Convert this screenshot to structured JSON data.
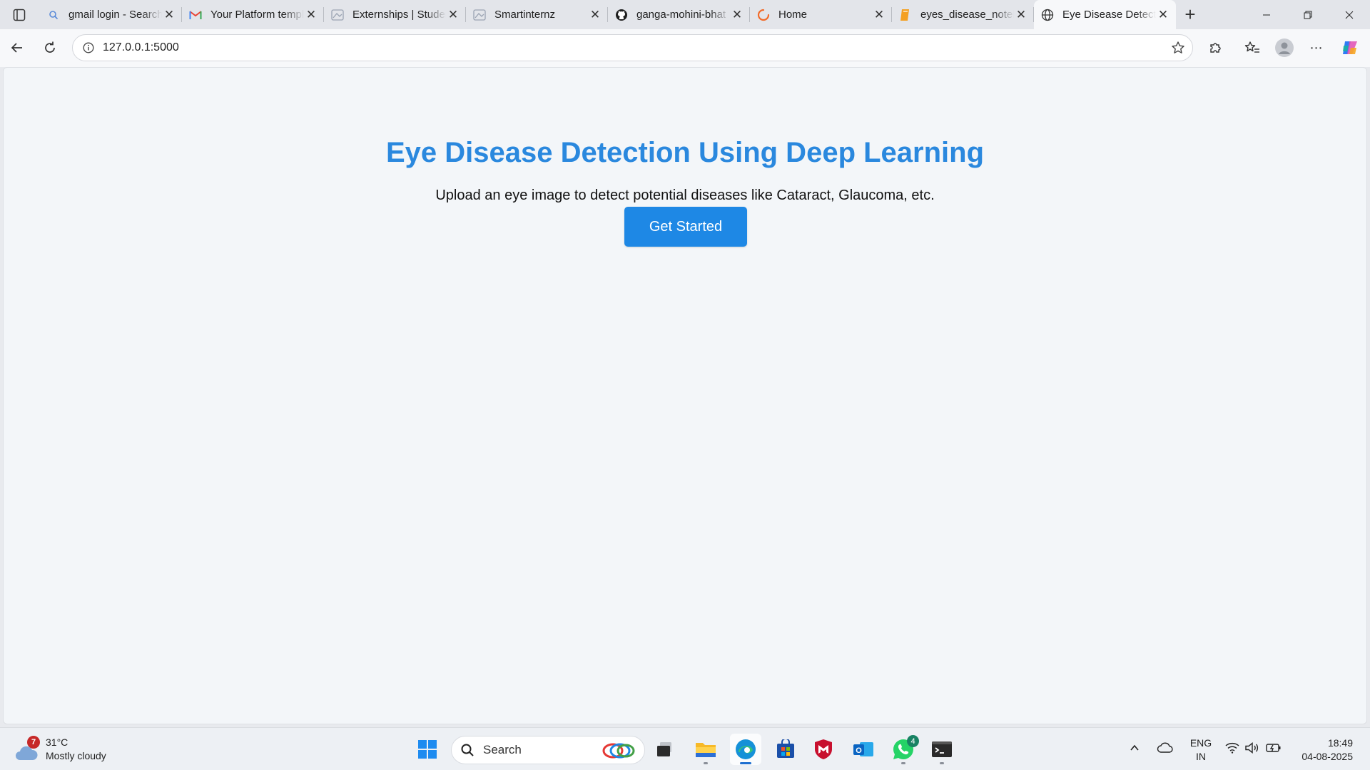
{
  "browser": {
    "tabs": [
      {
        "title": "gmail login - Search",
        "icon": "search-icon"
      },
      {
        "title": "Your Platform templates",
        "icon": "gmail-icon"
      },
      {
        "title": "Externships | Student",
        "icon": "page-icon"
      },
      {
        "title": "Smartinternz",
        "icon": "page-icon"
      },
      {
        "title": "ganga-mohini-bhat",
        "icon": "github-icon"
      },
      {
        "title": "Home",
        "icon": "loading-icon"
      },
      {
        "title": "eyes_disease_notebook",
        "icon": "notebook-icon"
      },
      {
        "title": "Eye Disease Detection",
        "icon": "globe-icon",
        "active": true
      }
    ],
    "url": "127.0.0.1:5000"
  },
  "page": {
    "heading": "Eye Disease Detection Using Deep Learning",
    "subtitle": "Upload an eye image to detect potential diseases like Cataract, Glaucoma, etc.",
    "cta_label": "Get Started",
    "heading_color": "#2a88de",
    "button_color": "#1e88e5"
  },
  "taskbar": {
    "weather": {
      "temp": "31°C",
      "condition": "Mostly cloudy",
      "alert_count": "7"
    },
    "search_label": "Search",
    "whatsapp_badge": "4",
    "lang_top": "ENG",
    "lang_bottom": "IN",
    "time": "18:49",
    "date": "04-08-2025"
  }
}
